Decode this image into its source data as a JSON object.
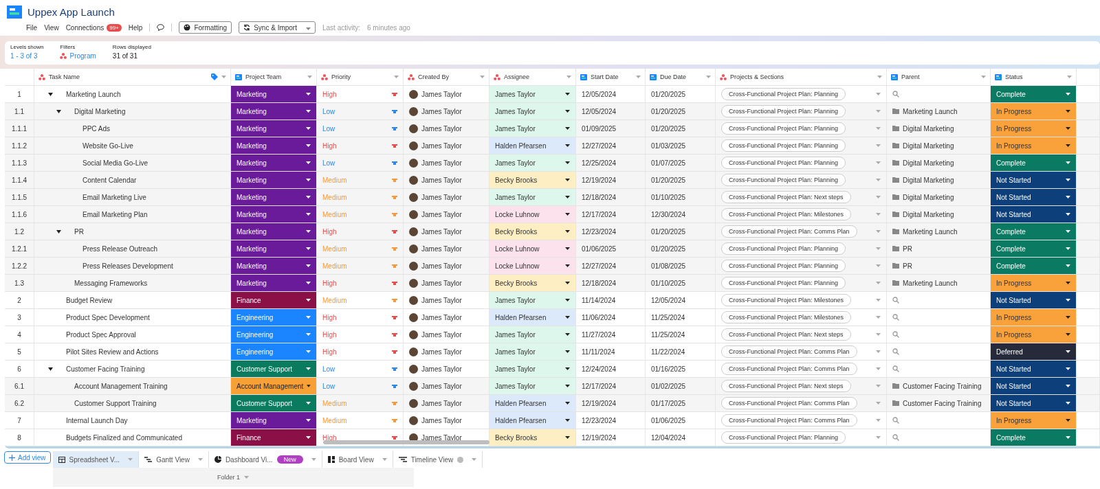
{
  "app": {
    "title": "Uppex App Launch",
    "menu": [
      "File",
      "View",
      "Connections",
      "Help"
    ],
    "connections_badge": "99+",
    "buttons": [
      {
        "label": "Formatting",
        "kind": "palette"
      },
      {
        "label": "Sync & Import",
        "kind": "sync"
      }
    ],
    "last_activity_label": "Last activity:",
    "last_activity": "6 minutes ago"
  },
  "summary": [
    {
      "label": "Levels shown",
      "value": "1 - 3 of 3",
      "kind": "link"
    },
    {
      "label": "Filters",
      "value": "Program",
      "kind": "filter"
    },
    {
      "label": "Rows displayed",
      "value": "31 of 31",
      "kind": "plain"
    }
  ],
  "columns": [
    {
      "label": "Task Name",
      "kind": "dots"
    },
    {
      "label": "Project Team",
      "kind": "card"
    },
    {
      "label": "Priority",
      "kind": "dots"
    },
    {
      "label": "Created By",
      "kind": "dots"
    },
    {
      "label": "Assignee",
      "kind": "dots"
    },
    {
      "label": "Start Date",
      "kind": "card"
    },
    {
      "label": "Due Date",
      "kind": "card"
    },
    {
      "label": "Projects & Sections",
      "kind": "dots"
    },
    {
      "label": "Parent",
      "kind": "card"
    },
    {
      "label": "Status",
      "kind": "card"
    }
  ],
  "rows": [
    {
      "num": "1",
      "task": "Marketing Launch",
      "expanded": true,
      "team": {
        "label": "Marketing",
        "color": "#6a1b9a"
      },
      "priority": {
        "label": "High",
        "color": "#e84d4d"
      },
      "created": "James Taylor",
      "assignee": {
        "label": "James Taylor",
        "color": "#ddf7ec"
      },
      "start": "12/05/2024",
      "due": "01/20/2025",
      "projects": "Cross-Functional Project Plan: Planning",
      "status": {
        "label": "Complete",
        "color": "#0b7a62"
      },
      "children": [
        {
          "num": "1.1",
          "task": "Digital Marketing",
          "expanded": true,
          "team": {
            "label": "Marketing",
            "color": "#6a1b9a"
          },
          "priority": {
            "label": "Low",
            "color": "#2f87e8"
          },
          "created": "James Taylor",
          "assignee": {
            "label": "James Taylor",
            "color": "#ddf7ec"
          },
          "start": "12/05/2024",
          "due": "01/20/2025",
          "projects": "Cross-Functional Project Plan: Planning",
          "parent": "Marketing Launch",
          "status": {
            "label": "In Progress",
            "color": "#f9a13a"
          },
          "children": [
            {
              "num": "1.1.1",
              "task": "PPC Ads",
              "team": {
                "label": "Marketing",
                "color": "#6a1b9a"
              },
              "priority": {
                "label": "Low",
                "color": "#2f87e8"
              },
              "created": "James Taylor",
              "assignee": {
                "label": "James Taylor",
                "color": "#ddf7ec"
              },
              "start": "01/09/2025",
              "due": "01/20/2025",
              "projects": "Cross-Functional Project Plan: Planning",
              "parent": "Digital Marketing",
              "status": {
                "label": "In Progress",
                "color": "#f9a13a"
              }
            },
            {
              "num": "1.1.2",
              "task": "Website Go-Live",
              "team": {
                "label": "Marketing",
                "color": "#6a1b9a"
              },
              "priority": {
                "label": "High",
                "color": "#e84d4d"
              },
              "created": "James Taylor",
              "assignee": {
                "label": "Halden Pfearsen",
                "color": "#dce9fb"
              },
              "start": "12/27/2024",
              "due": "01/03/2025",
              "projects": "Cross-Functional Project Plan: Planning",
              "parent": "Digital Marketing",
              "status": {
                "label": "In Progress",
                "color": "#f9a13a"
              }
            },
            {
              "num": "1.1.3",
              "task": "Social Media Go-Live",
              "team": {
                "label": "Marketing",
                "color": "#6a1b9a"
              },
              "priority": {
                "label": "Low",
                "color": "#2f87e8"
              },
              "created": "James Taylor",
              "assignee": {
                "label": "James Taylor",
                "color": "#ddf7ec"
              },
              "start": "12/25/2024",
              "due": "01/07/2025",
              "projects": "Cross-Functional Project Plan: Planning",
              "parent": "Digital Marketing",
              "status": {
                "label": "Complete",
                "color": "#0b7a62"
              }
            },
            {
              "num": "1.1.4",
              "task": "Content Calendar",
              "team": {
                "label": "Marketing",
                "color": "#6a1b9a"
              },
              "priority": {
                "label": "Medium",
                "color": "#f59a3c"
              },
              "created": "James Taylor",
              "assignee": {
                "label": "Becky Brooks",
                "color": "#fdefc3"
              },
              "start": "12/19/2024",
              "due": "01/20/2025",
              "projects": "Cross-Functional Project Plan: Planning",
              "parent": "Digital Marketing",
              "status": {
                "label": "Not Started",
                "color": "#0d3f7a"
              }
            },
            {
              "num": "1.1.5",
              "task": "Email Marketing Live",
              "team": {
                "label": "Marketing",
                "color": "#6a1b9a"
              },
              "priority": {
                "label": "Medium",
                "color": "#f59a3c"
              },
              "created": "James Taylor",
              "assignee": {
                "label": "James Taylor",
                "color": "#ddf7ec"
              },
              "start": "12/18/2024",
              "due": "01/10/2025",
              "projects": "Cross-Functional Project Plan: Next steps",
              "parent": "Digital Marketing",
              "status": {
                "label": "Not Started",
                "color": "#0d3f7a"
              }
            },
            {
              "num": "1.1.6",
              "task": "Email Marketing Plan",
              "team": {
                "label": "Marketing",
                "color": "#6a1b9a"
              },
              "priority": {
                "label": "Medium",
                "color": "#f59a3c"
              },
              "created": "James Taylor",
              "assignee": {
                "label": "Locke Luhnow",
                "color": "#fbe2ec"
              },
              "start": "12/17/2024",
              "due": "12/30/2024",
              "projects": "Cross-Functional Project Plan: Milestones",
              "parent": "Digital Marketing",
              "status": {
                "label": "Not Started",
                "color": "#0d3f7a"
              }
            }
          ]
        },
        {
          "num": "1.2",
          "task": "PR",
          "expanded": true,
          "team": {
            "label": "Marketing",
            "color": "#6a1b9a"
          },
          "priority": {
            "label": "High",
            "color": "#e84d4d"
          },
          "created": "James Taylor",
          "assignee": {
            "label": "Becky Brooks",
            "color": "#fdefc3"
          },
          "start": "12/23/2024",
          "due": "01/20/2025",
          "projects": "Cross-Functional Project Plan: Comms Plan",
          "parent": "Marketing Launch",
          "status": {
            "label": "Complete",
            "color": "#0b7a62"
          },
          "children": [
            {
              "num": "1.2.1",
              "task": "Press Release Outreach",
              "team": {
                "label": "Marketing",
                "color": "#6a1b9a"
              },
              "priority": {
                "label": "Medium",
                "color": "#f59a3c"
              },
              "created": "James Taylor",
              "assignee": {
                "label": "Locke Luhnow",
                "color": "#fbe2ec"
              },
              "start": "01/06/2025",
              "due": "01/20/2025",
              "projects": "Cross-Functional Project Plan: Planning",
              "parent": "PR",
              "status": {
                "label": "Complete",
                "color": "#0b7a62"
              }
            },
            {
              "num": "1.2.2",
              "task": "Press Releases Development",
              "team": {
                "label": "Marketing",
                "color": "#6a1b9a"
              },
              "priority": {
                "label": "Medium",
                "color": "#f59a3c"
              },
              "created": "James Taylor",
              "assignee": {
                "label": "Locke Luhnow",
                "color": "#fbe2ec"
              },
              "start": "12/27/2024",
              "due": "01/08/2025",
              "projects": "Cross-Functional Project Plan: Planning",
              "parent": "PR",
              "status": {
                "label": "Complete",
                "color": "#0b7a62"
              }
            }
          ]
        },
        {
          "num": "1.3",
          "task": "Messaging Frameworks",
          "team": {
            "label": "Marketing",
            "color": "#6a1b9a"
          },
          "priority": {
            "label": "High",
            "color": "#e84d4d"
          },
          "created": "James Taylor",
          "assignee": {
            "label": "Becky Brooks",
            "color": "#fdefc3"
          },
          "start": "12/18/2024",
          "due": "01/10/2025",
          "projects": "Cross-Functional Project Plan: Planning",
          "parent": "Marketing Launch",
          "status": {
            "label": "In Progress",
            "color": "#f9a13a"
          }
        }
      ]
    },
    {
      "num": "2",
      "task": "Budget Review",
      "team": {
        "label": "Finance",
        "color": "#8b1048"
      },
      "priority": {
        "label": "Medium",
        "color": "#f59a3c"
      },
      "created": "James Taylor",
      "assignee": {
        "label": "James Taylor",
        "color": "#ddf7ec"
      },
      "start": "11/14/2024",
      "due": "12/05/2024",
      "projects": "Cross-Functional Project Plan: Milestones",
      "status": {
        "label": "Not Started",
        "color": "#0d3f7a"
      }
    },
    {
      "num": "3",
      "task": "Product Spec Development",
      "team": {
        "label": "Engineering",
        "color": "#1a85ff"
      },
      "priority": {
        "label": "High",
        "color": "#e84d4d"
      },
      "created": "James Taylor",
      "assignee": {
        "label": "Halden Pfearsen",
        "color": "#dce9fb"
      },
      "start": "11/06/2024",
      "due": "11/25/2024",
      "projects": "Cross-Functional Project Plan: Milestones",
      "status": {
        "label": "In Progress",
        "color": "#f9a13a"
      }
    },
    {
      "num": "4",
      "task": "Product Spec Approval",
      "team": {
        "label": "Engineering",
        "color": "#1a85ff"
      },
      "priority": {
        "label": "High",
        "color": "#e84d4d"
      },
      "created": "James Taylor",
      "assignee": {
        "label": "James Taylor",
        "color": "#ddf7ec"
      },
      "start": "11/27/2024",
      "due": "11/25/2024",
      "projects": "Cross-Functional Project Plan: Next steps",
      "status": {
        "label": "In Progress",
        "color": "#f9a13a"
      }
    },
    {
      "num": "5",
      "task": "Pilot Sites Review and Actions",
      "team": {
        "label": "Engineering",
        "color": "#1a85ff"
      },
      "priority": {
        "label": "High",
        "color": "#e84d4d"
      },
      "created": "James Taylor",
      "assignee": {
        "label": "James Taylor",
        "color": "#ddf7ec"
      },
      "start": "11/11/2024",
      "due": "11/22/2024",
      "projects": "Cross-Functional Project Plan: Comms Plan",
      "status": {
        "label": "Deferred",
        "color": "#262a3a"
      }
    },
    {
      "num": "6",
      "task": "Customer Facing Training",
      "expanded": true,
      "team": {
        "label": "Customer Support",
        "color": "#0a7b5e"
      },
      "priority": {
        "label": "Low",
        "color": "#2f87e8"
      },
      "created": "James Taylor",
      "assignee": {
        "label": "James Taylor",
        "color": "#ddf7ec"
      },
      "start": "12/24/2024",
      "due": "01/16/2025",
      "projects": "Cross-Functional Project Plan: Comms Plan",
      "status": {
        "label": "Not Started",
        "color": "#0d3f7a"
      },
      "children": [
        {
          "num": "6.1",
          "task": "Account Management Training",
          "team": {
            "label": "Account Management",
            "color": "#f7a035"
          },
          "priority": {
            "label": "Low",
            "color": "#2f87e8"
          },
          "created": "James Taylor",
          "assignee": {
            "label": "James Taylor",
            "color": "#ddf7ec"
          },
          "start": "12/17/2024",
          "due": "01/02/2025",
          "projects": "Cross-Functional Project Plan: Next steps",
          "parent": "Customer Facing Training",
          "status": {
            "label": "Not Started",
            "color": "#0d3f7a"
          }
        },
        {
          "num": "6.2",
          "task": "Customer Support Training",
          "team": {
            "label": "Customer Support",
            "color": "#0a7b5e"
          },
          "priority": {
            "label": "Medium",
            "color": "#f59a3c"
          },
          "created": "James Taylor",
          "assignee": {
            "label": "Halden Pfearsen",
            "color": "#dce9fb"
          },
          "start": "12/19/2024",
          "due": "01/17/2025",
          "projects": "Cross-Functional Project Plan: Comms Plan",
          "parent": "Customer Facing Training",
          "status": {
            "label": "Not Started",
            "color": "#0d3f7a"
          }
        }
      ]
    },
    {
      "num": "7",
      "task": "Internal Launch Day",
      "team": {
        "label": "Marketing",
        "color": "#6a1b9a"
      },
      "priority": {
        "label": "Medium",
        "color": "#f59a3c"
      },
      "created": "James Taylor",
      "assignee": {
        "label": "Halden Pfearsen",
        "color": "#dce9fb"
      },
      "start": "12/23/2024",
      "due": "01/06/2025",
      "projects": "Cross-Functional Project Plan: Comms Plan",
      "status": {
        "label": "In Progress",
        "color": "#f9a13a"
      }
    },
    {
      "num": "8",
      "task": "Budgets Finalized and Communicated",
      "team": {
        "label": "Finance",
        "color": "#8b1048"
      },
      "priority": {
        "label": "High",
        "color": "#e84d4d"
      },
      "created": "James Taylor",
      "assignee": {
        "label": "Becky Brooks",
        "color": "#fdefc3"
      },
      "start": "12/19/2024",
      "due": "12/04/2024",
      "projects": "Cross-Functional Project Plan: Planning",
      "status": {
        "label": "Complete",
        "color": "#0b7a62"
      }
    }
  ],
  "add_view": "Add view",
  "views": [
    {
      "label": "Spreadsheet V...",
      "kind": "grid",
      "selected": true
    },
    {
      "label": "Gantt View",
      "kind": "gantt",
      "selected": false
    },
    {
      "label": "Dashboard Vi...",
      "kind": "pie",
      "selected": false,
      "badge": "New"
    },
    {
      "label": "Board View",
      "kind": "board",
      "selected": false
    },
    {
      "label": "Timeline View",
      "kind": "timeline",
      "selected": false,
      "help": true
    }
  ],
  "folder": "Folder 1"
}
